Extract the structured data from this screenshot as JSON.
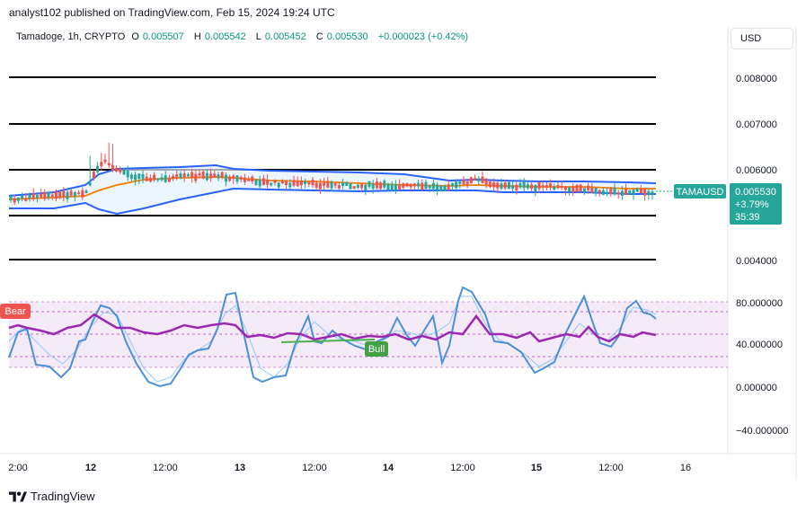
{
  "header": {
    "publisher_line": "analyst102 published on TradingView.com, Feb 15, 2024 19:24 UTC"
  },
  "legend": {
    "symbol": "Tamadoge, 1h, CRYPTO",
    "open_label": "O",
    "open": "0.005507",
    "high_label": "H",
    "high": "0.005542",
    "low_label": "L",
    "low": "0.005452",
    "close_label": "C",
    "close": "0.005530",
    "change": "+0.000023 (+0.42%)"
  },
  "currency": "USD",
  "price_axis": {
    "ticks": [
      "0.008000",
      "0.007000",
      "0.006000",
      "0.004000"
    ],
    "symbol_tag": "TAMAUSD",
    "last_price": "0.005530",
    "last_change": "+3.79%",
    "countdown": "35:39"
  },
  "osc_axis": {
    "ticks": [
      "80.000000",
      "40.000000",
      "0.000000",
      "−40.000000"
    ]
  },
  "time_axis": {
    "ticks": [
      "2:00",
      "12",
      "12:00",
      "13",
      "12:00",
      "14",
      "12:00",
      "15",
      "12:00",
      "16"
    ]
  },
  "osc_labels": {
    "bear": "Bear",
    "bull": "Bull"
  },
  "footer": {
    "brand": "TradingView"
  },
  "colors": {
    "up": "#26a69a",
    "down": "#ef5350",
    "bb": "#2962ff",
    "ma": "#f57c00",
    "rsi": "#9c27b0",
    "stoch": "#4a90d9",
    "tag": "#26a69a"
  },
  "chart_data": {
    "type": "line",
    "y_range": [
      0.0035,
      0.0088
    ],
    "horizontal_levels": [
      0.008,
      0.007,
      0.006,
      0.005,
      0.004
    ],
    "osc_range": [
      -50,
      100
    ]
  }
}
